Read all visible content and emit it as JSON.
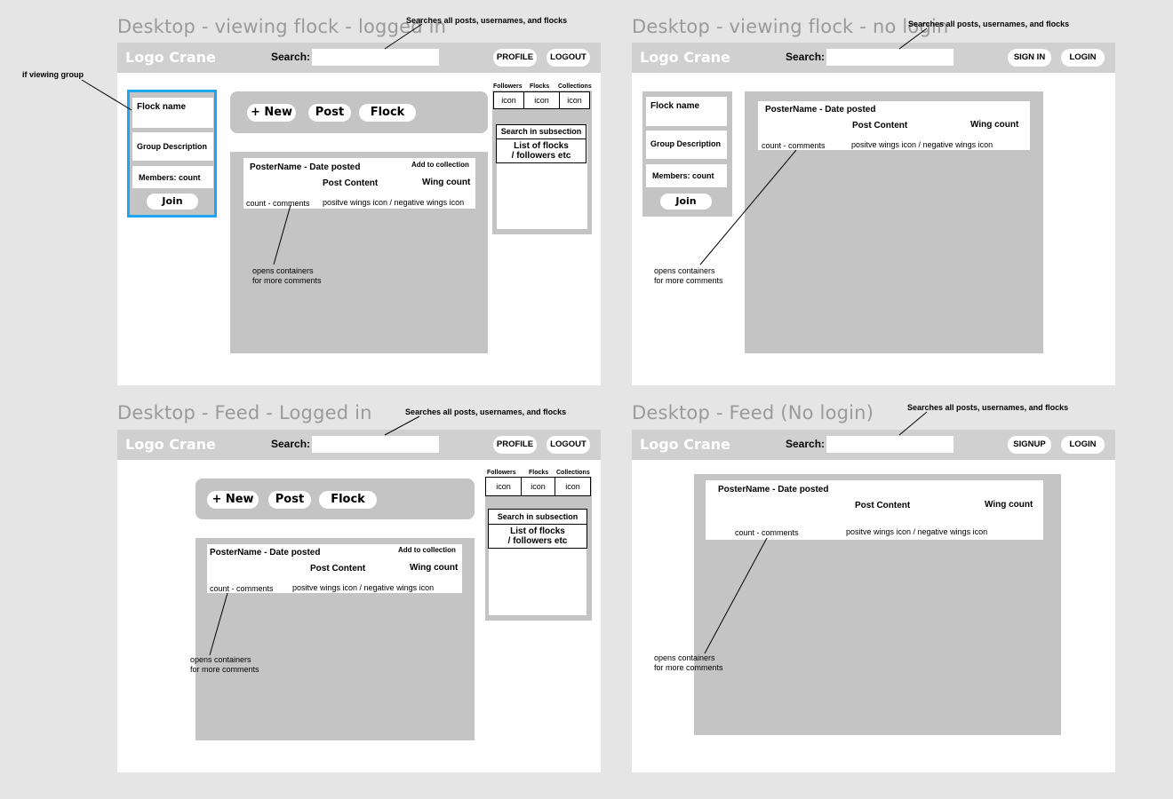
{
  "frames": [
    {
      "title": "Desktop - viewing flock - logged in",
      "search_note": "Searches all posts, usernames, and flocks",
      "logo": "Logo Crane",
      "search_label": "Search:",
      "nav": [
        "PROFILE",
        "LOGOUT"
      ],
      "side_note": "if viewing group",
      "flock_panel": {
        "name": "Flock name",
        "description": "Group Description",
        "members": "Members: count",
        "join": "Join"
      },
      "create_bar": [
        "+ New",
        "Post",
        "Flock"
      ],
      "post": {
        "poster": "PosterName - Date posted",
        "add_to_collection": "Add to collection",
        "content": "Post Content",
        "wing_count": "Wing count",
        "comments": "count - comments",
        "wings": "positve wings icon / negative wings icon"
      },
      "comment_note": [
        "opens containers",
        "for more comments"
      ],
      "right_panel": {
        "tabs": [
          "Followers",
          "Flocks",
          "Collections"
        ],
        "icons": [
          "icon",
          "icon",
          "icon"
        ],
        "search_sub": "Search in subsection",
        "list": [
          "List of flocks",
          "/ followers etc"
        ]
      }
    },
    {
      "title": "Desktop - viewing flock - no login",
      "search_note": "Searches all posts, usernames, and flocks",
      "logo": "Logo Crane",
      "search_label": "Search:",
      "nav": [
        "SIGN IN",
        "LOGIN"
      ],
      "flock_panel": {
        "name": "Flock name",
        "description": "Group Description",
        "members": "Members: count",
        "join": "Join"
      },
      "post": {
        "poster": "PosterName - Date posted",
        "content": "Post Content",
        "wing_count": "Wing count",
        "comments": "count - comments",
        "wings": "positve wings icon / negative wings icon"
      },
      "comment_note": [
        "opens containers",
        "for more comments"
      ]
    },
    {
      "title": "Desktop - Feed - Logged in",
      "search_note": "Searches all posts, usernames, and flocks",
      "logo": "Logo Crane",
      "search_label": "Search:",
      "nav": [
        "PROFILE",
        "LOGOUT"
      ],
      "create_bar": [
        "+ New",
        "Post",
        "Flock"
      ],
      "post": {
        "poster": "PosterName - Date posted",
        "add_to_collection": "Add to collection",
        "content": "Post Content",
        "wing_count": "Wing count",
        "comments": "count - comments",
        "wings": "positve wings icon / negative wings icon"
      },
      "comment_note": [
        "opens containers",
        "for more comments"
      ],
      "right_panel": {
        "tabs": [
          "Followers",
          "Flocks",
          "Collections"
        ],
        "icons": [
          "icon",
          "icon",
          "icon"
        ],
        "search_sub": "Search in subsection",
        "list": [
          "List of flocks",
          "/ followers etc"
        ]
      }
    },
    {
      "title": "Desktop - Feed (No login)",
      "search_note": "Searches all posts, usernames, and flocks",
      "logo": "Logo Crane",
      "search_label": "Search:",
      "nav": [
        "SIGNUP",
        "LOGIN"
      ],
      "post": {
        "poster": "PosterName - Date posted",
        "content": "Post Content",
        "wing_count": "Wing count",
        "comments": "count - comments",
        "wings": "positve wings icon / negative wings icon"
      },
      "comment_note": [
        "opens containers",
        "for more comments"
      ]
    }
  ],
  "colors": {
    "canvas": "#e5e5e5",
    "frame": "#ffffff",
    "header": "#d0d0d0",
    "panel": "#c4c4c4",
    "highlight": "#1ea7f0",
    "title": "#9a9a9a"
  }
}
